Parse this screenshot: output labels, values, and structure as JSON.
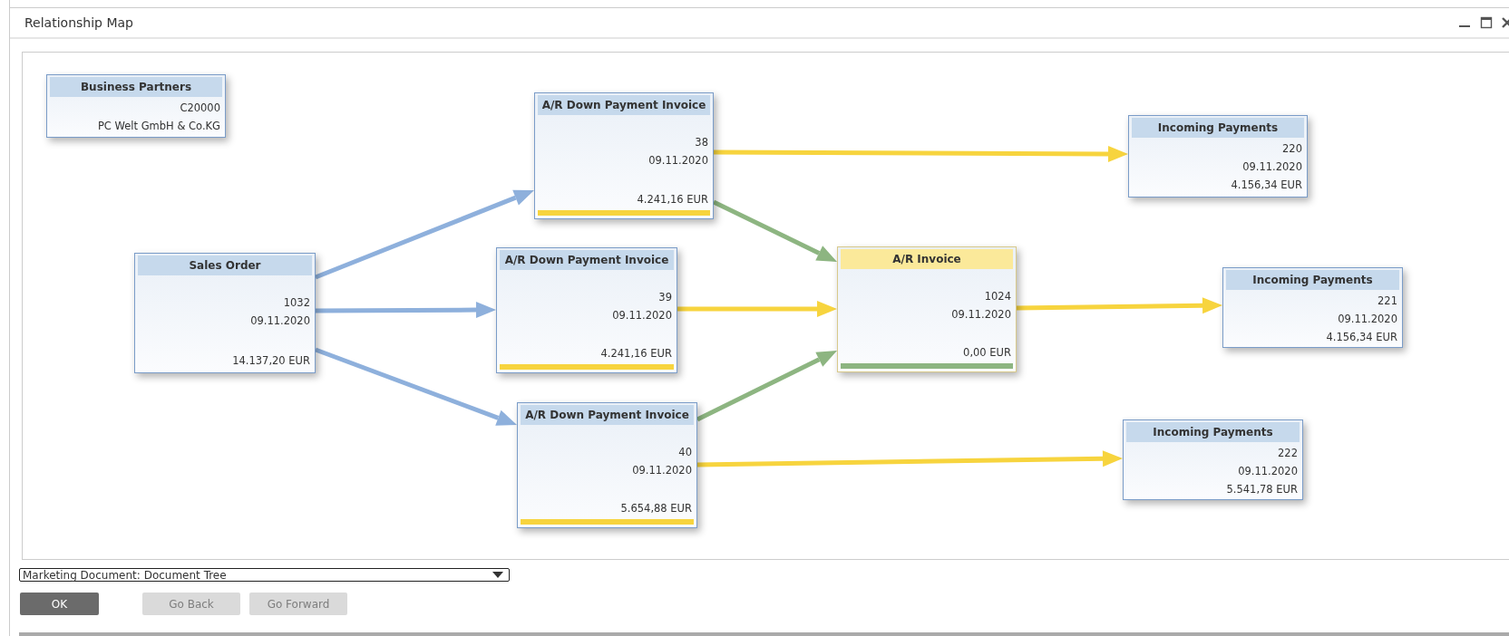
{
  "window": {
    "title": "Relationship Map"
  },
  "nodes": [
    {
      "kind": "partner",
      "title": "Business Partners",
      "selected": false,
      "lines": [
        "C20000",
        "PC Welt GmbH & Co.KG"
      ]
    },
    {
      "kind": "document",
      "title": "Sales Order",
      "selected": false,
      "lines": [
        "1032",
        "09.11.2020"
      ],
      "amount": "14.137,20 EUR"
    },
    {
      "kind": "document",
      "title": "A/R Down Payment Invoice",
      "selected": false,
      "lines": [
        "38",
        "09.11.2020"
      ],
      "amount": "4.241,16 EUR",
      "color": "#f7d43e"
    },
    {
      "kind": "document",
      "title": "A/R Down Payment Invoice",
      "selected": false,
      "lines": [
        "39",
        "09.11.2020"
      ],
      "amount": "4.241,16 EUR",
      "color": "#f7d43e"
    },
    {
      "kind": "document",
      "title": "A/R Down Payment Invoice",
      "selected": false,
      "lines": [
        "40",
        "09.11.2020"
      ],
      "amount": "5.654,88 EUR",
      "color": "#f7d43e"
    },
    {
      "kind": "document",
      "title": "A/R Invoice",
      "selected": true,
      "lines": [
        "1024",
        "09.11.2020"
      ],
      "amount": "0,00 EUR",
      "color": "#8db581"
    },
    {
      "kind": "payment",
      "title": "Incoming Payments",
      "selected": false,
      "lines": [
        "220",
        "09.11.2020",
        "4.156,34 EUR"
      ]
    },
    {
      "kind": "payment",
      "title": "Incoming Payments",
      "selected": false,
      "lines": [
        "221",
        "09.11.2020",
        "4.156,34 EUR"
      ]
    },
    {
      "kind": "payment",
      "title": "Incoming Payments",
      "selected": false,
      "lines": [
        "222",
        "09.11.2020",
        "5.541,78 EUR"
      ]
    }
  ],
  "links": [
    {
      "color": "#8eb0dc"
    },
    {
      "color": "#8eb0dc"
    },
    {
      "color": "#8eb0dc"
    },
    {
      "color": "#8db581"
    },
    {
      "color": "#f7d43e"
    },
    {
      "color": "#8db581"
    },
    {
      "color": "#f7d43e"
    },
    {
      "color": "#f7d43e"
    },
    {
      "color": "#f7d43e"
    }
  ],
  "view_select": {
    "value": "Marketing Document: Document Tree"
  },
  "buttons": [
    {
      "label": "OK",
      "disabled": false
    },
    {
      "label": "Go Back",
      "disabled": true
    },
    {
      "label": "Go Forward",
      "disabled": true
    }
  ]
}
